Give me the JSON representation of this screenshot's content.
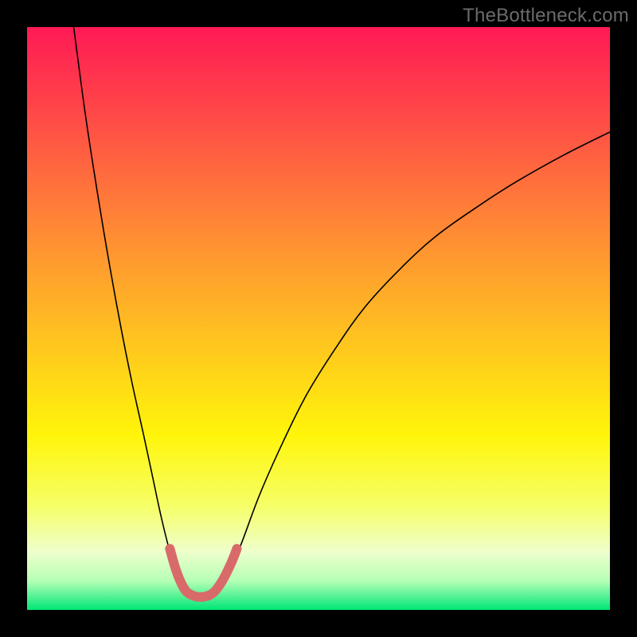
{
  "watermark": "TheBottleneck.com",
  "chart_data": {
    "type": "line",
    "title": "",
    "xlabel": "",
    "ylabel": "",
    "xlim": [
      0,
      100
    ],
    "ylim": [
      0,
      100
    ],
    "grid": false,
    "legend": false,
    "background_gradient": {
      "stops": [
        {
          "offset": 0.0,
          "color": "#ff1a55"
        },
        {
          "offset": 0.12,
          "color": "#ff3f4a"
        },
        {
          "offset": 0.25,
          "color": "#ff6a3e"
        },
        {
          "offset": 0.4,
          "color": "#ff9a2f"
        },
        {
          "offset": 0.55,
          "color": "#ffc81e"
        },
        {
          "offset": 0.7,
          "color": "#fff50a"
        },
        {
          "offset": 0.82,
          "color": "#f6ff66"
        },
        {
          "offset": 0.9,
          "color": "#eeffcc"
        },
        {
          "offset": 0.95,
          "color": "#b6ffb6"
        },
        {
          "offset": 1.0,
          "color": "#00e676"
        }
      ]
    },
    "series": [
      {
        "name": "bottleneck-curve",
        "color": "#000000",
        "width": 1.6,
        "points": [
          {
            "x": 8.0,
            "y": 100.0
          },
          {
            "x": 10.0,
            "y": 85.0
          },
          {
            "x": 12.0,
            "y": 72.0
          },
          {
            "x": 14.0,
            "y": 60.0
          },
          {
            "x": 16.0,
            "y": 49.0
          },
          {
            "x": 18.0,
            "y": 39.0
          },
          {
            "x": 20.0,
            "y": 30.0
          },
          {
            "x": 21.5,
            "y": 23.0
          },
          {
            "x": 23.0,
            "y": 16.0
          },
          {
            "x": 24.5,
            "y": 10.0
          },
          {
            "x": 26.0,
            "y": 5.5
          },
          {
            "x": 27.5,
            "y": 3.0
          },
          {
            "x": 29.0,
            "y": 2.0
          },
          {
            "x": 31.0,
            "y": 2.0
          },
          {
            "x": 33.0,
            "y": 3.5
          },
          {
            "x": 35.0,
            "y": 7.0
          },
          {
            "x": 37.0,
            "y": 12.0
          },
          {
            "x": 40.0,
            "y": 20.0
          },
          {
            "x": 44.0,
            "y": 29.0
          },
          {
            "x": 48.0,
            "y": 37.0
          },
          {
            "x": 53.0,
            "y": 45.0
          },
          {
            "x": 58.0,
            "y": 52.0
          },
          {
            "x": 64.0,
            "y": 58.5
          },
          {
            "x": 70.0,
            "y": 64.0
          },
          {
            "x": 77.0,
            "y": 69.0
          },
          {
            "x": 84.0,
            "y": 73.5
          },
          {
            "x": 92.0,
            "y": 78.0
          },
          {
            "x": 100.0,
            "y": 82.0
          }
        ]
      },
      {
        "name": "optimal-range-highlight",
        "color": "#d86a6a",
        "width": 12,
        "linecap": "round",
        "points": [
          {
            "x": 24.5,
            "y": 10.5
          },
          {
            "x": 25.5,
            "y": 7.0
          },
          {
            "x": 26.5,
            "y": 4.5
          },
          {
            "x": 27.5,
            "y": 3.0
          },
          {
            "x": 29.0,
            "y": 2.3
          },
          {
            "x": 30.5,
            "y": 2.3
          },
          {
            "x": 32.0,
            "y": 3.0
          },
          {
            "x": 33.5,
            "y": 5.0
          },
          {
            "x": 35.0,
            "y": 8.0
          },
          {
            "x": 36.0,
            "y": 10.5
          }
        ]
      }
    ]
  }
}
